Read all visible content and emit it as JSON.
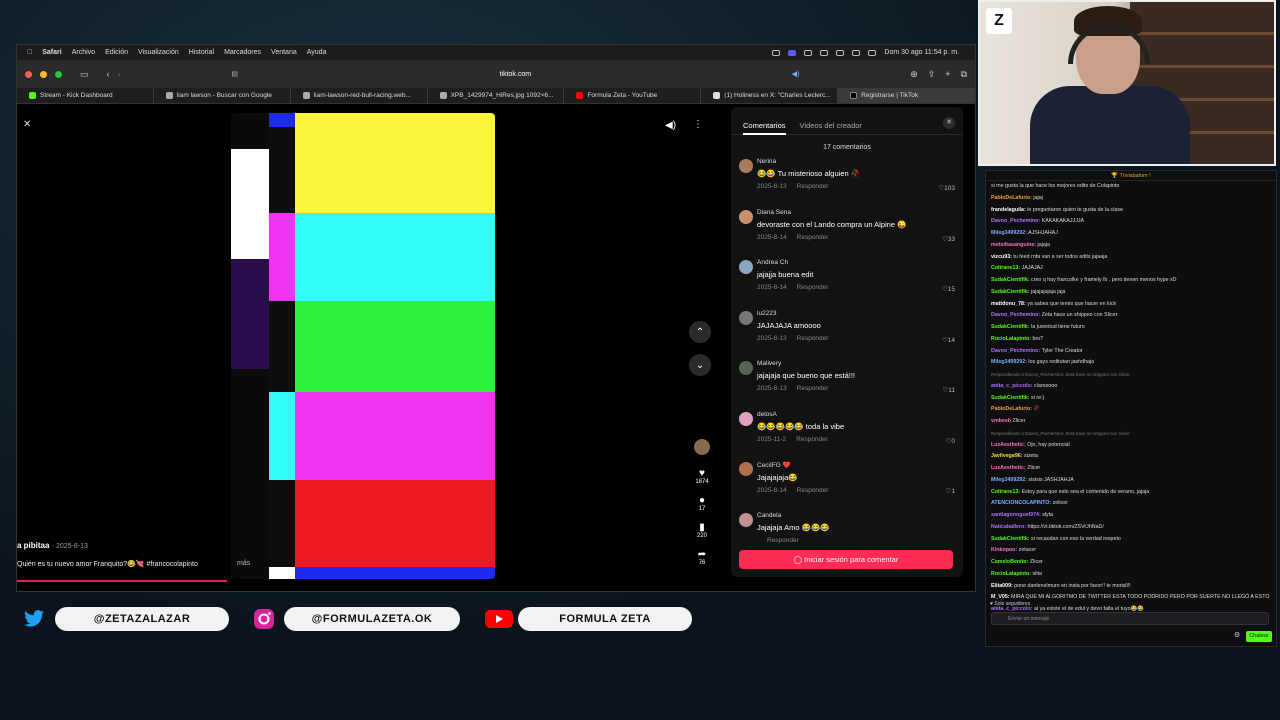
{
  "menubar": {
    "items": [
      "Safari",
      "Archivo",
      "Edición",
      "Visualización",
      "Historial",
      "Marcadores",
      "Ventana",
      "Ayuda"
    ],
    "clock": "Dom 30 ago  11:54 p. m."
  },
  "toolbar": {
    "url": "tiktok.com"
  },
  "tabs": [
    {
      "label": "Stream - Kick Dashboard",
      "color": "#53fc18"
    },
    {
      "label": "liam lawson - Buscar con Google",
      "color": "#aaaaaa"
    },
    {
      "label": "liam-lawson-red-bull-racing.web...",
      "color": "#aaaaaa"
    },
    {
      "label": "XPB_1429974_HiRes.jpg 1092×6...",
      "color": "#aaaaaa"
    },
    {
      "label": "Formula Zeta - YouTube",
      "color": "#ff0000"
    },
    {
      "label": "(1) Holiness en X: \"Charles Leclerc...",
      "color": "#dddddd"
    },
    {
      "label": "Registrarse | TikTok",
      "color": "#000000"
    }
  ],
  "video": {
    "author": "a pibitaa",
    "date": "· 2025-8-13",
    "caption": "Quién es tu nuevo amor Franquito?😂💘 #francocolapinto",
    "more": "más",
    "likes": "1874",
    "comments": "17",
    "saves": "220",
    "shares": "76",
    "bars": [
      "#f8f53a",
      "#33fdf7",
      "#2ff03a",
      "#f034f2",
      "#ef1a21",
      "#1d2af0"
    ]
  },
  "comments_panel": {
    "tab_comments": "Comentarios",
    "tab_creator": "Videos del creador",
    "count": "17 comentarios",
    "reply": "Responder",
    "login": "Iniciar sesión para comentar",
    "items": [
      {
        "name": "Nerina",
        "text": "😂😂 Tu misterioso alguien 🥀",
        "date": "2025-8-13",
        "likes": "103",
        "color": "#a87b5a"
      },
      {
        "name": "Diana Sena",
        "text": "devoraste con el Lando compra un Alpine 😜",
        "date": "2025-8-14",
        "likes": "33",
        "color": "#c8906c"
      },
      {
        "name": "Andrea Ch",
        "text": "jajajja buena edit",
        "date": "2025-8-14",
        "likes": "15",
        "color": "#8aa6c0"
      },
      {
        "name": "lu2223",
        "text": "JAJAJAJA amoooo",
        "date": "2025-8-13",
        "likes": "14",
        "color": "#777777"
      },
      {
        "name": "Malivery",
        "text": "jajajaja que bueno que está!!!",
        "date": "2025-8-13",
        "likes": "11",
        "color": "#556655"
      },
      {
        "name": "delosA",
        "text": "😂😂😂😂😂 toda la vibe",
        "date": "2025-11-2",
        "likes": "0",
        "color": "#e0a0c0"
      },
      {
        "name": "CeciIFG ❤️",
        "text": "Jajajajaja😂",
        "date": "2025-8-14",
        "likes": "1",
        "color": "#b07050"
      },
      {
        "name": "Candela",
        "text": "Jajajaja Amo 😂😂😂",
        "date": "",
        "likes": "",
        "color": "#c09090"
      }
    ]
  },
  "chat": {
    "banner": "🏆 Trivialadom !",
    "lines": [
      {
        "u": "",
        "c": "#ffffff",
        "t": "si me gusta la que hace los mejores edits de Colapinto"
      },
      {
        "u": "PabloDeLafurio:",
        "c": "#f0a040",
        "t": "jajaj"
      },
      {
        "u": "frandelaguila:",
        "c": "#ffffff",
        "t": "le preguntaron quien te gusta de la clase"
      },
      {
        "u": "Davoo_Pechemino:",
        "c": "#b070ff",
        "t": "KAKAKAKAJJJJA"
      },
      {
        "u": "Mileg3499292:",
        "c": "#7ab0ff",
        "t": "AJSHJAHAJ"
      },
      {
        "u": "metsiltasanguine:",
        "c": "#ff70c0",
        "t": "jajaja"
      },
      {
        "u": "vizcu93:",
        "c": "#ffffff",
        "t": "tu feed rnfa van a ser todos edits jajaaja"
      },
      {
        "u": "Coltrane13:",
        "c": "#53fc18",
        "t": "JAJAJAJ"
      },
      {
        "u": "SudakCientifik:",
        "c": "#53fc18",
        "t": "creo q hay francolke y framely lb , pero tienen menos hype xD"
      },
      {
        "u": "SudakCientifik:",
        "c": "#53fc18",
        "t": "jajajajajaja jaja"
      },
      {
        "u": "mattdonu_78:",
        "c": "#ffffff",
        "t": "ya sabes que tenés que hacer en kick"
      },
      {
        "u": "Davoo_Pechemino:",
        "c": "#b070ff",
        "t": "Zeta hace un shippeo con Slicer"
      },
      {
        "u": "SudakCientifik:",
        "c": "#53fc18",
        "t": "la juventud tiene futuro"
      },
      {
        "u": "RocioLalapinto:",
        "c": "#53fc18",
        "t": "bro?"
      },
      {
        "u": "Davoo_Pechemino:",
        "c": "#b070ff",
        "t": "Tyler The Creator"
      },
      {
        "u": "Mileg3499292:",
        "c": "#7ab0ff",
        "t": "los gays reditutan jashdhaja"
      },
      {
        "u": "",
        "c": "#777777",
        "t": "Respondiendo a Davoo_Pechemino: Zeta hace un shippeo con Slicer",
        "sys": true
      },
      {
        "u": "anita_c_piccolo:",
        "c": "#b070ff",
        "t": "clarooooo"
      },
      {
        "u": "SudakCientifik:",
        "c": "#53fc18",
        "t": "si re:)"
      },
      {
        "u": "PabloDeLafurio:",
        "c": "#f0a040",
        "t": "🥀"
      },
      {
        "u": "vmbeeb",
        "c": "#ff70c0",
        "t": "Zlicer"
      },
      {
        "u": "",
        "c": "#777777",
        "t": "Respondiendo a Davoo_Pechemino: Zeta hace un shippeo con Slicer",
        "sys": true
      },
      {
        "u": "LuzAesthetic:",
        "c": "#ff70c0",
        "t": "Ojo, hay potencial"
      },
      {
        "u": "Javilvega96:",
        "c": "#f0e040",
        "t": "sizeta"
      },
      {
        "u": "LuzAesthetic:",
        "c": "#ff70c0",
        "t": "Zlicer"
      },
      {
        "u": "Mileg3499292:",
        "c": "#7ab0ff",
        "t": "sisisis JASHJAHJA"
      },
      {
        "u": "Coltrane13:",
        "c": "#53fc18",
        "t": "Estoy para que esto sea el contenido de verano, jajaja"
      },
      {
        "u": "ATENCIONCOLAPINTO:",
        "c": "#7ab0ff",
        "t": "zelicer"
      },
      {
        "u": "santiagonoguel974:",
        "c": "#b070ff",
        "t": "slyta"
      },
      {
        "u": "Naticaballero:",
        "c": "#b070ff",
        "t": "https://vt.tiktok.com/ZSVrJhNaD/"
      },
      {
        "u": "SudakCientifik:",
        "c": "#53fc18",
        "t": "si recaudan con eso la verdad respeto"
      },
      {
        "u": "Kinkopoo:",
        "c": "#ff70c0",
        "t": "zetacer"
      },
      {
        "u": "CameloBenito:",
        "c": "#53fc18",
        "t": "Zlicer"
      },
      {
        "u": "RocioLalapinto:",
        "c": "#53fc18",
        "t": "slita"
      },
      {
        "u": "Elita009:",
        "c": "#ffffff",
        "t": "pone danlenelmuro en insta por favor!! te morisll!!"
      },
      {
        "u": "M_V05:",
        "c": "#ffffff",
        "t": "MIRA QUE MI ALGORITMO DE TWITTER ESTA TODO PODRIDO PERO POR SUERTE NO LLEGÓ A ESTO"
      },
      {
        "u": "anita_c_piccolo:",
        "c": "#b070ff",
        "t": "al ya existe el de edul y devo falta el tuyo😂😂"
      }
    ],
    "followers": "♥ Solo seguidores",
    "input_placeholder": "Enviar un mensaje",
    "send": "Chatear"
  },
  "socials": {
    "twitter": "@ZETAZALAZAR",
    "instagram": "@FORMULAZETA.OK",
    "youtube": "FORMULA ZETA"
  }
}
